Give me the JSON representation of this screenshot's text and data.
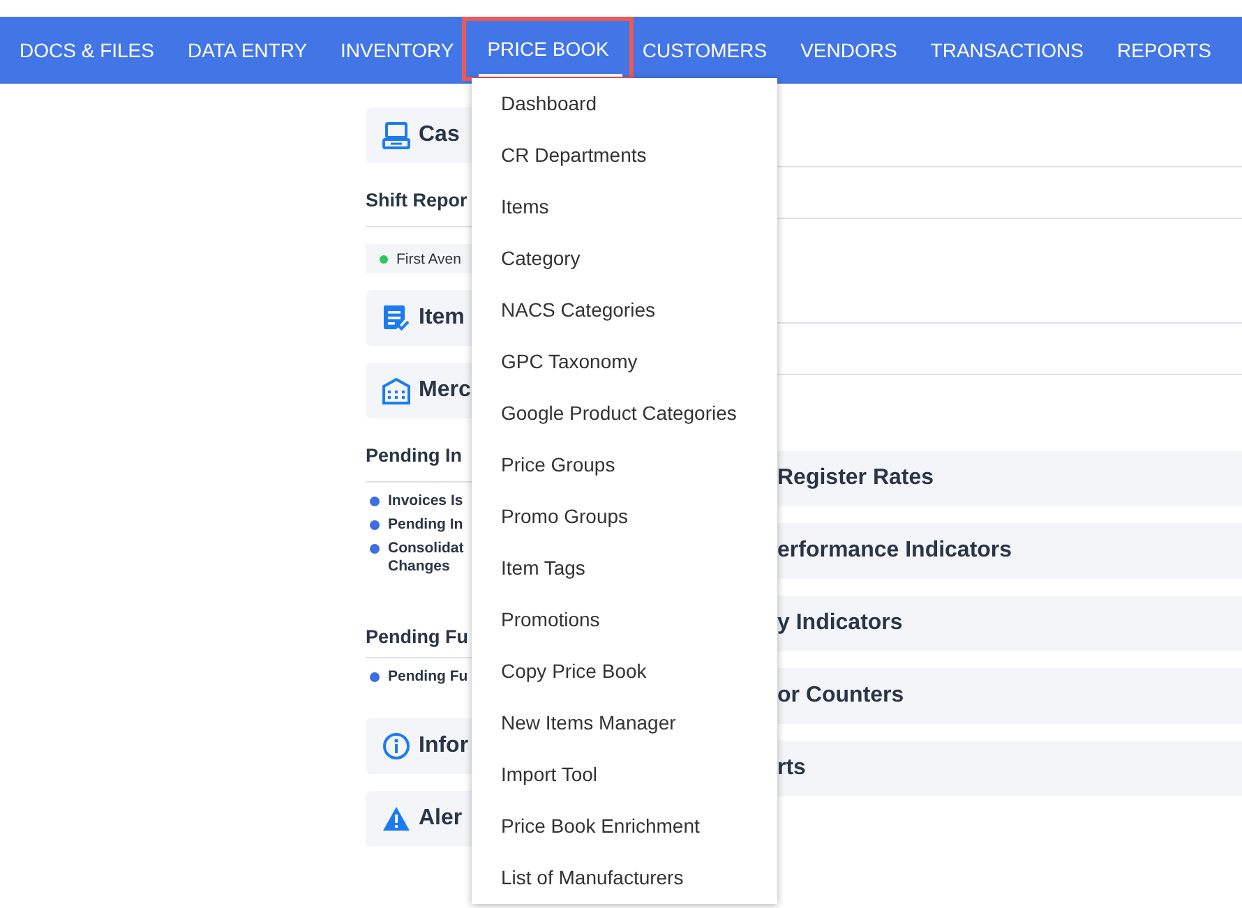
{
  "nav": {
    "tabs": [
      {
        "label": "DOCS & FILES",
        "selected": false
      },
      {
        "label": "DATA ENTRY",
        "selected": false
      },
      {
        "label": "INVENTORY",
        "selected": false
      },
      {
        "label": "PRICE BOOK",
        "selected": true
      },
      {
        "label": "CUSTOMERS",
        "selected": false
      },
      {
        "label": "VENDORS",
        "selected": false
      },
      {
        "label": "TRANSACTIONS",
        "selected": false
      },
      {
        "label": "REPORTS",
        "selected": false
      }
    ]
  },
  "dropdown": {
    "items": [
      "Dashboard",
      "CR Departments",
      "Items",
      "Category",
      "NACS Categories",
      "GPC Taxonomy",
      "Google Product Categories",
      "Price Groups",
      "Promo Groups",
      "Item Tags",
      "Promotions",
      "Copy Price Book",
      "New Items Manager",
      "Import Tool",
      "Price Book Enrichment",
      "List of Manufacturers"
    ]
  },
  "left_column": [
    {
      "kind": "card",
      "title": "Cas"
    },
    {
      "kind": "heading",
      "title": "Shift Repor"
    },
    {
      "kind": "status",
      "text": "First Aven",
      "color": "#2ec65a"
    },
    {
      "kind": "card",
      "title": "Item"
    },
    {
      "kind": "card",
      "title": "Merc"
    },
    {
      "kind": "heading",
      "title": "Pending In"
    },
    {
      "kind": "bullets",
      "items": [
        "Invoices Is",
        "Pending In",
        "Consolidat Changes"
      ]
    },
    {
      "kind": "heading",
      "title": "Pending Fu"
    },
    {
      "kind": "bullets",
      "items": [
        "Pending Fu"
      ]
    },
    {
      "kind": "card",
      "title": "Infor"
    },
    {
      "kind": "card",
      "title": "Aler"
    }
  ],
  "right_column": {
    "panels": [
      "Register Rates",
      "erformance Indicators",
      "y Indicators",
      "or Counters",
      "rts"
    ]
  }
}
